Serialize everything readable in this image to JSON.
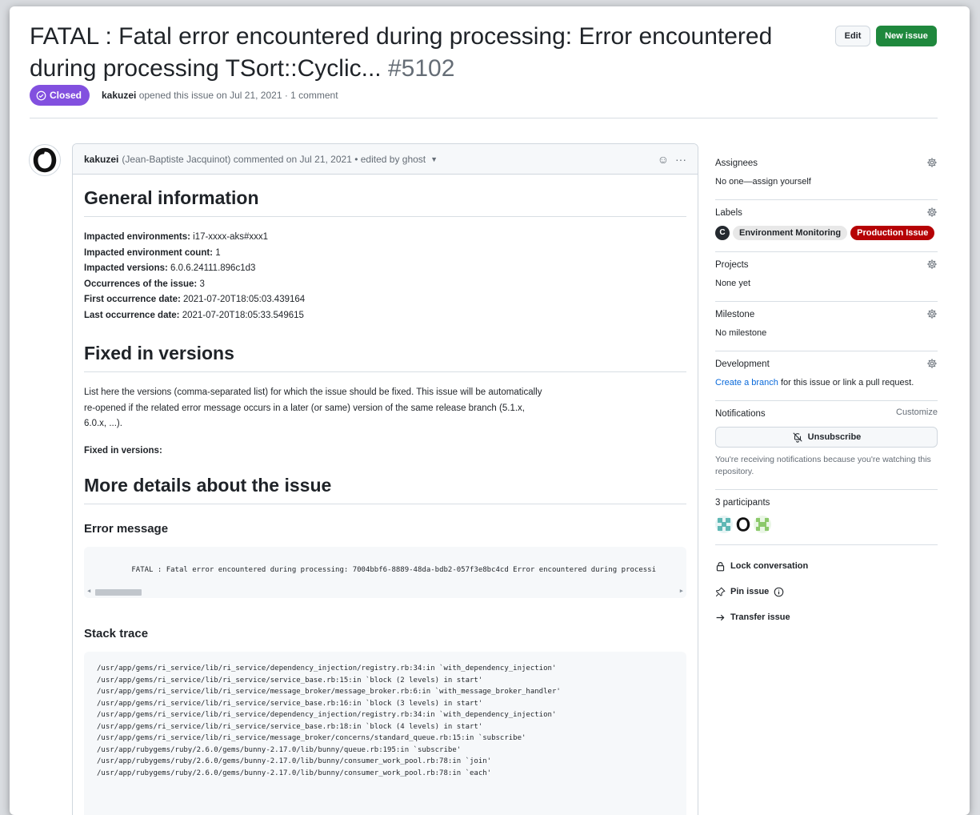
{
  "issue": {
    "title": "FATAL : Fatal error encountered during processing: Error encountered during processing TSort::Cyclic...",
    "number": "#5102",
    "edit_label": "Edit",
    "new_issue_label": "New issue",
    "status": "Closed",
    "author": "kakuzei",
    "meta_text": "opened this issue on Jul 21, 2021 · 1 comment"
  },
  "comment": {
    "author": "kakuzei",
    "author_fullname": "(Jean-Baptiste Jacquinot)",
    "meta": "commented on Jul 21, 2021 • edited by ghost",
    "general_heading": "General information",
    "info": [
      {
        "label": "Impacted environments:",
        "value": "i17-xxxx-aks#xxx1"
      },
      {
        "label": "Impacted environment count:",
        "value": "1"
      },
      {
        "label": "Impacted versions:",
        "value": "6.0.6.24111.896c1d3"
      },
      {
        "label": "Occurrences of the issue:",
        "value": "3"
      },
      {
        "label": "First occurrence date:",
        "value": "2021-07-20T18:05:03.439164"
      },
      {
        "label": "Last occurrence date:",
        "value": "2021-07-20T18:05:33.549615"
      }
    ],
    "fixed_heading": "Fixed in versions",
    "fixed_paragraph": "List here the versions (comma-separated list) for which the issue should be fixed. This issue will be automatically re-opened if the related error message occurs in a later (or same) version of the same release branch (5.1.x, 6.0.x, ...).",
    "fixed_in_label": "Fixed in versions:",
    "details_heading": "More details about the issue",
    "error_heading": "Error message",
    "error_message": "FATAL : Fatal error encountered during processing: 7004bbf6-8889-48da-bdb2-057f3e8bc4cd Error encountered during processi",
    "stack_heading": "Stack trace",
    "stack_trace": "/usr/app/gems/ri_service/lib/ri_service/dependency_injection/registry.rb:34:in `with_dependency_injection'\n/usr/app/gems/ri_service/lib/ri_service/service_base.rb:15:in `block (2 levels) in start'\n/usr/app/gems/ri_service/lib/ri_service/message_broker/message_broker.rb:6:in `with_message_broker_handler'\n/usr/app/gems/ri_service/lib/ri_service/service_base.rb:16:in `block (3 levels) in start'\n/usr/app/gems/ri_service/lib/ri_service/dependency_injection/registry.rb:34:in `with_dependency_injection'\n/usr/app/gems/ri_service/lib/ri_service/service_base.rb:18:in `block (4 levels) in start'\n/usr/app/gems/ri_service/lib/ri_service/message_broker/concerns/standard_queue.rb:15:in `subscribe'\n/usr/app/rubygems/ruby/2.6.0/gems/bunny-2.17.0/lib/bunny/queue.rb:195:in `subscribe'\n/usr/app/rubygems/ruby/2.6.0/gems/bunny-2.17.0/lib/bunny/consumer_work_pool.rb:78:in `join'\n/usr/app/rubygems/ruby/2.6.0/gems/bunny-2.17.0/lib/bunny/consumer_work_pool.rb:78:in `each'"
  },
  "sidebar": {
    "assignees_heading": "Assignees",
    "assignees_value": "No one—assign yourself",
    "labels_heading": "Labels",
    "label_initial": "C",
    "labels": [
      "Environment Monitoring",
      "Production Issue"
    ],
    "projects_heading": "Projects",
    "projects_value": "None yet",
    "milestone_heading": "Milestone",
    "milestone_value": "No milestone",
    "development_heading": "Development",
    "development_link": "Create a branch",
    "development_rest": " for this issue or link a pull request.",
    "notifications_heading": "Notifications",
    "customize_label": "Customize",
    "unsubscribe_label": "Unsubscribe",
    "notifications_text": "You're receiving notifications because you're watching this repository.",
    "participants_heading": "3 participants",
    "lock_label": "Lock conversation",
    "pin_label": "Pin issue",
    "transfer_label": "Transfer issue"
  },
  "colors": {
    "closed": "#8250df",
    "new_issue": "#1f883d",
    "production_label": "#b60205",
    "link": "#0969da"
  }
}
